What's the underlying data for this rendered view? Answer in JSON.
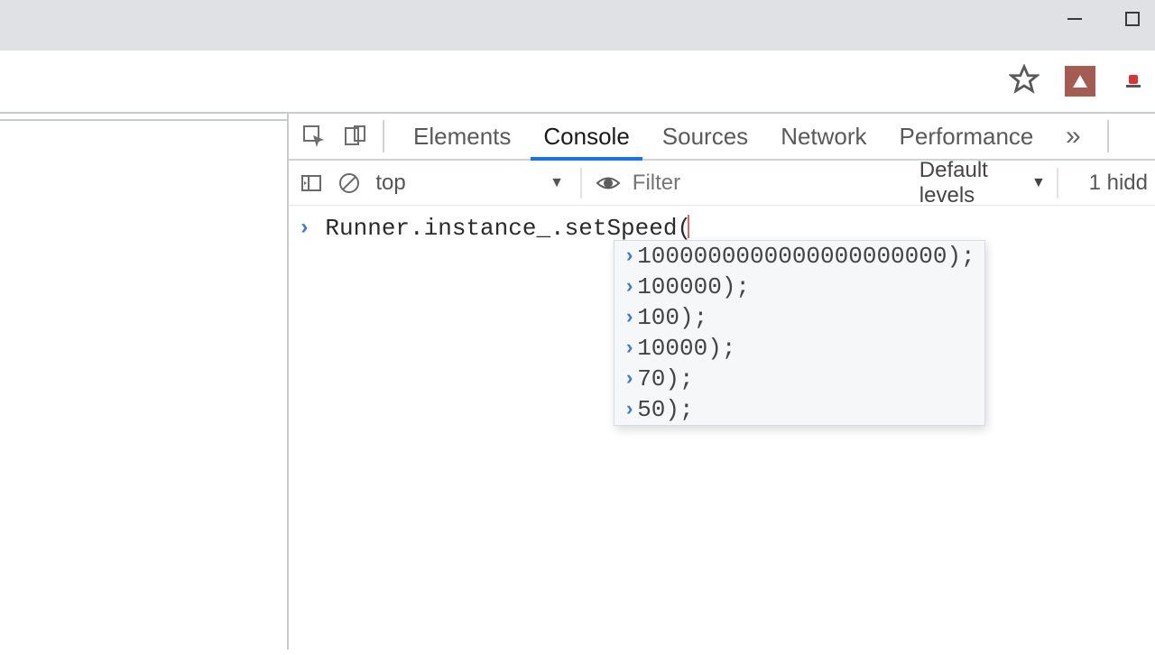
{
  "window_controls": {
    "min": "minimize",
    "max": "maximize"
  },
  "devtools": {
    "tabs": {
      "elements": "Elements",
      "console": "Console",
      "sources": "Sources",
      "network": "Network",
      "performance": "Performance",
      "more": "»"
    },
    "active_tab": "console",
    "toolbar": {
      "context": "top",
      "filter_placeholder": "Filter",
      "levels_label": "Default levels",
      "hidden_label": "1 hidd"
    },
    "console": {
      "input": "Runner.instance_.setSpeed(",
      "autocomplete": [
        "1000000000000000000000);",
        "100000);",
        "100);",
        "10000);",
        "70);",
        "50);"
      ]
    }
  }
}
